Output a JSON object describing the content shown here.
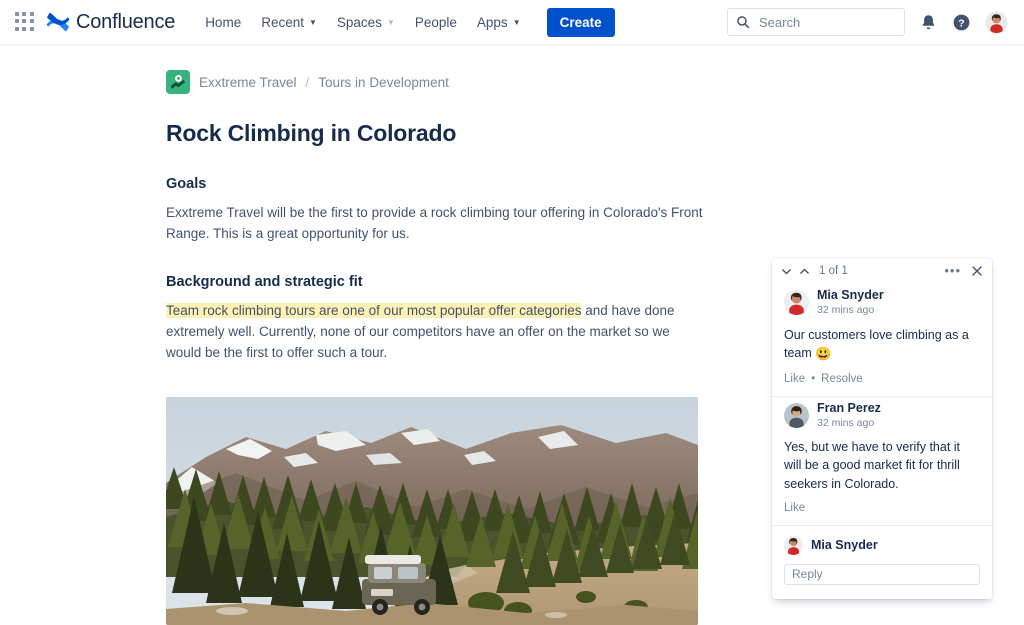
{
  "topnav": {
    "app_switcher_icon": "grid-apps-icon",
    "brand_logo_icon": "confluence-logo-icon",
    "brand_name": "Confluence",
    "items": [
      {
        "label": "Home",
        "has_caret": false
      },
      {
        "label": "Recent",
        "has_caret": true
      },
      {
        "label": "Spaces",
        "has_caret": true,
        "caret_dim": true
      },
      {
        "label": "People",
        "has_caret": false
      },
      {
        "label": "Apps",
        "has_caret": true
      }
    ],
    "create_label": "Create",
    "search": {
      "icon": "search-icon",
      "placeholder": "Search",
      "value": ""
    },
    "notifications_icon": "bell-icon",
    "help_icon": "question-circle-icon",
    "profile_avatar": "user-avatar"
  },
  "page": {
    "breadcrumb": {
      "space_icon": "map-pin-space-icon",
      "space": "Exxtreme Travel",
      "separator": "/",
      "parent": "Tours in Development"
    },
    "title": "Rock Climbing in Colorado",
    "sections": [
      {
        "heading": "Goals",
        "paragraph": "Exxtreme Travel will be the first to provide a rock climbing tour offering in Colorado's Front Range. This is a great opportunity for us."
      },
      {
        "heading": "Background and strategic fit",
        "highlighted": "Team rock climbing tours are one of our most popular offer categories",
        "paragraph_rest": " and have done extremely well. Currently, none of our competitors have an offer on the market so we would be the first to offer such a tour."
      }
    ],
    "photo_alt": "Mountain landscape with pine forest, snowy peak and a parked SUV"
  },
  "comment_panel": {
    "prev_icon": "chevron-down-icon",
    "next_icon": "chevron-up-icon",
    "counter": "1 of 1",
    "more_icon": "more-options-icon",
    "more_label": "•••",
    "close_icon": "close-icon",
    "comments": [
      {
        "avatar": "mia-snyder-avatar",
        "author": "Mia Snyder",
        "time": "32 mins ago",
        "text": "Our customers love climbing as a team ",
        "emoji": "😃",
        "actions": [
          "Like",
          "Resolve"
        ],
        "action_separator": "•"
      },
      {
        "avatar": "fran-perez-avatar",
        "author": "Fran Perez",
        "time": "32 mins ago",
        "text": "Yes, but we have to verify that it will be a good market fit for thrill seekers in Colorado.",
        "emoji": "",
        "actions": [
          "Like"
        ],
        "action_separator": ""
      }
    ],
    "reply": {
      "avatar": "mia-snyder-avatar",
      "author": "Mia Snyder",
      "placeholder": "Reply",
      "value": ""
    }
  },
  "colors": {
    "brand_blue": "#0052CC",
    "text_dark": "#172B4D",
    "text_subtle": "#6B778C",
    "space_green": "#36B37E",
    "highlight_yellow": "#FFF0B3",
    "border": "#DFE1E6"
  }
}
